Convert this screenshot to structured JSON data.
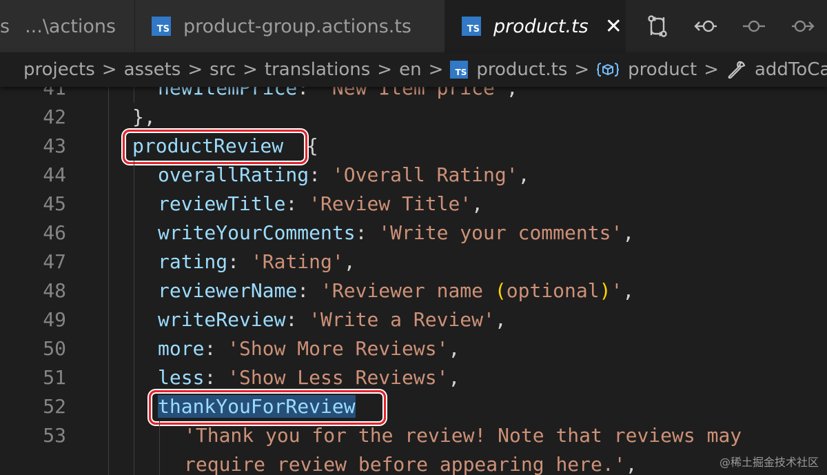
{
  "tabs": [
    {
      "label": "s",
      "path_hint": "...\\actions"
    },
    {
      "label": "product-group.actions.ts",
      "icon": "TS"
    },
    {
      "label": "product.ts",
      "icon": "TS",
      "active": true
    }
  ],
  "breadcrumb": {
    "items": [
      "projects",
      "assets",
      "src",
      "translations",
      "en"
    ],
    "file": "product.ts",
    "symbol": "product",
    "method": "addToCart",
    "separator": ">"
  },
  "code": {
    "lines": [
      {
        "n": "41",
        "key": "newItemPrice",
        "value": "'New Item price'"
      },
      {
        "n": "42",
        "text": "},"
      },
      {
        "n": "43",
        "key": "productReview",
        "rest": "{"
      },
      {
        "n": "44",
        "key": "overallRating",
        "value": "'Overall Rating'"
      },
      {
        "n": "45",
        "key": "reviewTitle",
        "value": "'Review Title'"
      },
      {
        "n": "46",
        "key": "writeYourComments",
        "value": "'Write your comments'"
      },
      {
        "n": "47",
        "key": "rating",
        "value": "'Rating'"
      },
      {
        "n": "48",
        "key": "reviewerName",
        "value_a": "'Reviewer name ",
        "paren_open": "(",
        "value_b": "optional",
        "paren_close": ")",
        "value_c": "'"
      },
      {
        "n": "49",
        "key": "writeReview",
        "value": "'Write a Review'"
      },
      {
        "n": "50",
        "key": "more",
        "value": "'Show More Reviews'"
      },
      {
        "n": "51",
        "key": "less",
        "value": "'Show Less Reviews'"
      },
      {
        "n": "52",
        "key": "thankYouForReview"
      },
      {
        "n": "53",
        "value": "'Thank you for the review! Note that reviews may"
      },
      {
        "n": "",
        "value": "require review before appearing here.'"
      }
    ]
  },
  "watermark": "@稀土掘金技术社区",
  "colors": {
    "background": "#1e1e1e",
    "property": "#9cdcfe",
    "string": "#ce9178",
    "punctuation": "#d4d4d4",
    "bracket": "#ffd700",
    "highlight_box": "#e5222b",
    "ts_badge": "#3178c6"
  },
  "icons": [
    "ts-file-icon",
    "close-icon",
    "compare-changes-icon",
    "go-back-icon",
    "timeline-icon",
    "go-forward-icon",
    "symbol-object-icon",
    "wrench-icon",
    "chevron-right-icon"
  ]
}
